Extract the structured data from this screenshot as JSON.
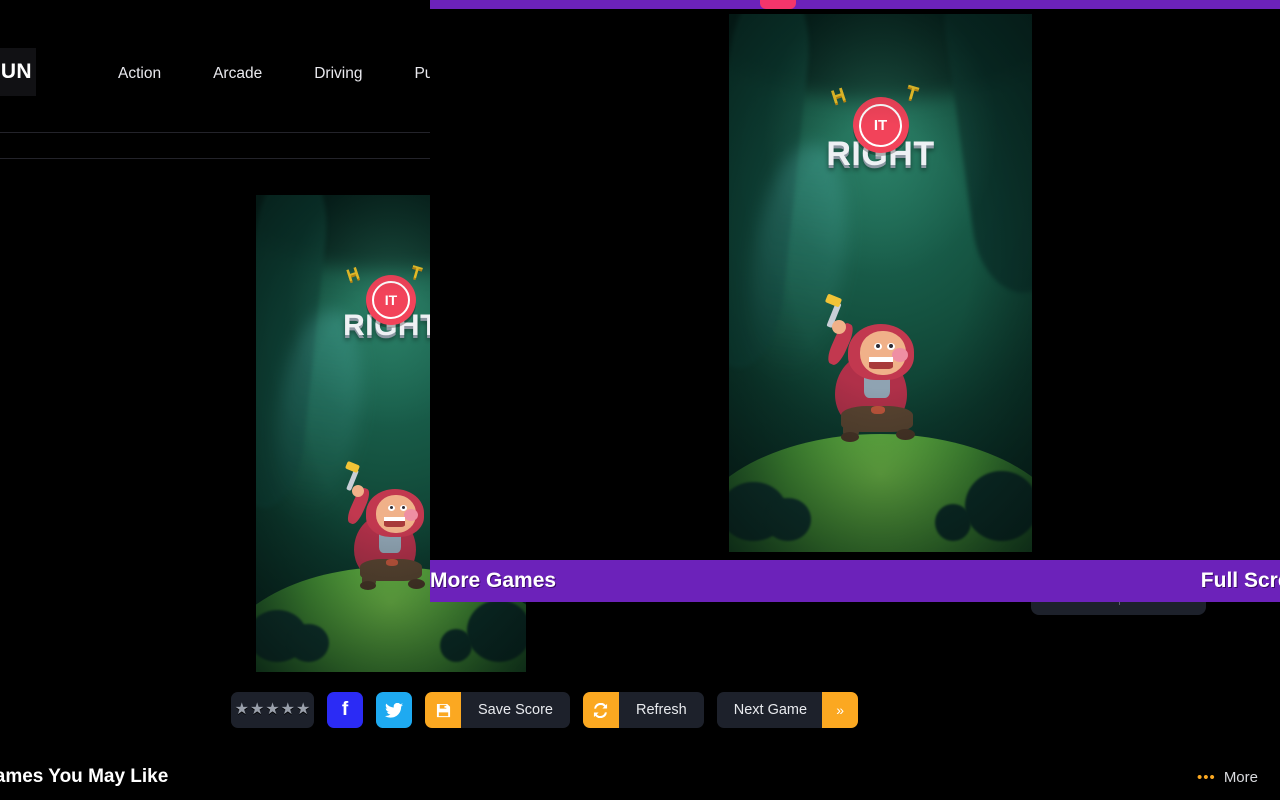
{
  "site": {
    "logo_text": "FUN",
    "nav": [
      {
        "label": "Action"
      },
      {
        "label": "Arcade"
      },
      {
        "label": "Driving"
      },
      {
        "label": "Pu"
      }
    ],
    "section_title": "Games You May Like",
    "more_label": "More",
    "more_dots": "•••"
  },
  "controls": {
    "rating_stars": "★★★★★",
    "facebook_label": "f",
    "twitter_label": "🐦",
    "save_score_icon": "💾",
    "save_score_label": "Save Score",
    "refresh_icon": "↻",
    "refresh_label": "Refresh",
    "next_game_label": "Next Game",
    "next_game_icon": "»"
  },
  "overlay": {
    "more_games_label": "More Games",
    "full_screen_label": "Full Screen",
    "purple_color": "#6c22ba",
    "accent_color": "#fba821"
  },
  "game": {
    "title": "HIT IT RIGHT",
    "logo_h": "H",
    "logo_t": "T",
    "logo_it": "IT",
    "logo_right": "RIGHT"
  },
  "hidden_widget": {
    "dots": "•••",
    "text": "——"
  }
}
